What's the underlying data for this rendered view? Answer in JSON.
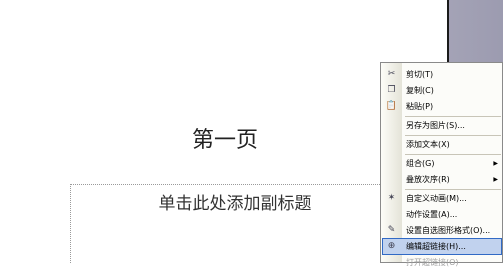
{
  "slide": {
    "title": "第一页",
    "subtitle_placeholder": "单击此处添加副标题"
  },
  "context_menu": {
    "items": [
      {
        "label": "剪切(T)",
        "icon": "scissors-icon",
        "glyph": "✂"
      },
      {
        "label": "复制(C)",
        "icon": "copy-icon",
        "glyph": "❐"
      },
      {
        "label": "粘贴(P)",
        "icon": "paste-icon",
        "glyph": "📋"
      },
      {
        "label": "另存为图片(S)..."
      },
      {
        "label": "添加文本(X)"
      },
      {
        "label": "组合(G)",
        "submenu": true
      },
      {
        "label": "叠放次序(R)",
        "submenu": true
      },
      {
        "label": "自定义动画(M)...",
        "icon": "custom-animation-icon",
        "glyph": "✶"
      },
      {
        "label": "动作设置(A)..."
      },
      {
        "label": "设置自选图形格式(O)...",
        "icon": "format-shape-icon",
        "glyph": "✎"
      },
      {
        "label": "编辑超链接(H)...",
        "icon": "hyperlink-icon",
        "glyph": "⊕",
        "highlighted": true
      },
      {
        "label": "打开超链接(O)",
        "disabled": true
      }
    ],
    "arrow_glyph": "▶"
  }
}
